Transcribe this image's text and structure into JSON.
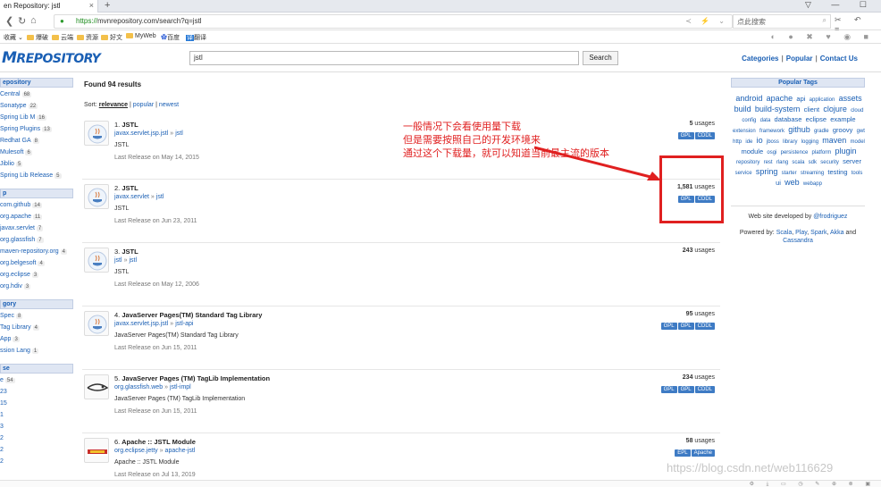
{
  "browser": {
    "tab_title": "en Repository: jstl",
    "close": "×",
    "new_tab": "+",
    "window_controls": "▽ — ☐",
    "nav_icons": {
      "back": "❮",
      "refresh": "↻",
      "home": "⌂"
    },
    "url_scheme": "https://",
    "url_rest": "mvnrepository.com/search?q=jstl",
    "url_tools": "≺ ⚡ ⌄",
    "search_placeholder": "点此搜索",
    "search_icon": "⌕",
    "menu_icons": "✂ ↶ ≡",
    "bookmarks": [
      "收藏",
      "爆破",
      "云端",
      "资源",
      "好文",
      "MyWeb",
      "百度",
      "翻译"
    ],
    "bookmarks_arrow": "⌄",
    "ext_icons": "◐ ● ✖ ♥ ◉ ■"
  },
  "site": {
    "logo_big": "M",
    "logo_text": "REPOSITORY",
    "query": "jstl",
    "search_button": "Search",
    "links": [
      "Categories",
      "Popular",
      "Contact Us"
    ],
    "link_sep": "|"
  },
  "sidebar": {
    "sections": [
      {
        "head": "epository",
        "items": [
          [
            "Central",
            "68"
          ],
          [
            "Sonatype",
            "22"
          ],
          [
            "Spring Lib M",
            "16"
          ],
          [
            "Spring Plugins",
            "13"
          ],
          [
            "Redhat GA",
            "8"
          ],
          [
            "Mulesoft",
            "6"
          ],
          [
            "Jiblio",
            "5"
          ],
          [
            "Spring Lib Release",
            "5"
          ]
        ]
      },
      {
        "head": "p",
        "items": [
          [
            "com.github",
            "14"
          ],
          [
            "org.apache",
            "11"
          ],
          [
            "javax.servlet",
            "7"
          ],
          [
            "org.glassfish",
            "7"
          ],
          [
            "maven-repository.org",
            "4"
          ],
          [
            "org.belgesoft",
            "4"
          ],
          [
            "org.eclipse",
            "3"
          ],
          [
            "org.hdiv",
            "3"
          ]
        ]
      },
      {
        "head": "gory",
        "items": [
          [
            "Spec",
            "8"
          ],
          [
            "Tag Library",
            "4"
          ],
          [
            "App",
            "3"
          ],
          [
            "ssion Lang",
            "1"
          ]
        ]
      },
      {
        "head": "se",
        "items": [
          [
            "e",
            "54"
          ],
          [
            "23",
            ""
          ],
          [
            "15",
            ""
          ],
          [
            "1",
            ""
          ],
          [
            "3",
            ""
          ],
          [
            "2",
            ""
          ],
          [
            "2",
            ""
          ],
          [
            "2",
            ""
          ]
        ]
      }
    ]
  },
  "results": {
    "found": "Found 94 results",
    "sort_label": "Sort:",
    "sort_options": [
      "relevance",
      "popular",
      "newest"
    ],
    "sort_sep": "|",
    "path_sep": "»",
    "usages_word": "usages",
    "items": [
      {
        "num": "1.",
        "title": "JSTL",
        "group": "javax.servlet.jsp.jstl",
        "artifact": "jstl",
        "desc": "JSTL",
        "date": "Last Release on May 14, 2015",
        "usages": "5",
        "licenses": [
          "GPL",
          "CDDL"
        ]
      },
      {
        "num": "2.",
        "title": "JSTL",
        "group": "javax.servlet",
        "artifact": "jstl",
        "desc": "JSTL",
        "date": "Last Release on Jun 23, 2011",
        "usages": "1,581",
        "licenses": [
          "GPL",
          "CDDL"
        ]
      },
      {
        "num": "3.",
        "title": "JSTL",
        "group": "jstl",
        "artifact": "jstl",
        "desc": "JSTL",
        "date": "Last Release on May 12, 2006",
        "usages": "243",
        "licenses": []
      },
      {
        "num": "4.",
        "title": "JavaServer Pages(TM) Standard Tag Library",
        "group": "javax.servlet.jsp.jstl",
        "artifact": "jstl-api",
        "desc": "JavaServer Pages(TM) Standard Tag Library",
        "date": "Last Release on Jun 15, 2011",
        "usages": "95",
        "licenses": [
          "GPL",
          "GPL",
          "CDDL"
        ]
      },
      {
        "num": "5.",
        "title": "JavaServer Pages (TM) TagLib Implementation",
        "group": "org.glassfish.web",
        "artifact": "jstl-impl",
        "desc": "JavaServer Pages (TM) TagLib Implementation",
        "date": "Last Release on Jun 15, 2011",
        "usages": "234",
        "licenses": [
          "GPL",
          "GPL",
          "CDDL"
        ]
      },
      {
        "num": "6.",
        "title": "Apache :: JSTL Module",
        "group": "org.eclipse.jetty",
        "artifact": "apache-jstl",
        "desc": "Apache :: JSTL Module",
        "date": "Last Release on Jul 13, 2019",
        "usages": "58",
        "licenses": [
          "EPL",
          "Apache"
        ]
      }
    ]
  },
  "right": {
    "tags_title": "Popular Tags",
    "tags": [
      [
        "android",
        3
      ],
      [
        "apache",
        3
      ],
      [
        "api",
        2
      ],
      [
        "application",
        1
      ],
      [
        "assets",
        3
      ],
      [
        "build",
        3
      ],
      [
        "build-system",
        3
      ],
      [
        "client",
        2
      ],
      [
        "clojure",
        3
      ],
      [
        "cloud",
        1
      ],
      [
        "config",
        1
      ],
      [
        "data",
        1
      ],
      [
        "database",
        2
      ],
      [
        "eclipse",
        2
      ],
      [
        "example",
        2
      ],
      [
        "extension",
        1
      ],
      [
        "framework",
        1
      ],
      [
        "github",
        3
      ],
      [
        "gradle",
        1
      ],
      [
        "groovy",
        2
      ],
      [
        "gwt",
        1
      ],
      [
        "http",
        1
      ],
      [
        "ide",
        1
      ],
      [
        "io",
        3
      ],
      [
        "jboss",
        1
      ],
      [
        "library",
        1
      ],
      [
        "logging",
        1
      ],
      [
        "maven",
        3
      ],
      [
        "model",
        1
      ],
      [
        "module",
        2
      ],
      [
        "osgi",
        1
      ],
      [
        "persistence",
        1
      ],
      [
        "platform",
        1
      ],
      [
        "plugin",
        3
      ],
      [
        "repository",
        1
      ],
      [
        "rest",
        1
      ],
      [
        "rlang",
        1
      ],
      [
        "scala",
        1
      ],
      [
        "sdk",
        1
      ],
      [
        "security",
        1
      ],
      [
        "server",
        2
      ],
      [
        "service",
        1
      ],
      [
        "spring",
        3
      ],
      [
        "starter",
        1
      ],
      [
        "streaming",
        1
      ],
      [
        "testing",
        2
      ],
      [
        "tools",
        1
      ],
      [
        "ui",
        2
      ],
      [
        "web",
        3
      ],
      [
        "webapp",
        1
      ]
    ],
    "dev_prefix": "Web site developed by",
    "dev_name": "@frodriguez",
    "powered_prefix": "Powered by:",
    "powered_parts": [
      [
        "Scala",
        ","
      ],
      [
        "Play",
        ","
      ],
      [
        "Spark",
        ","
      ],
      [
        "Akka",
        " and"
      ],
      [
        "Cassandra",
        ""
      ]
    ]
  },
  "annotation": {
    "lines": [
      "一般情况下会看使用量下载",
      "但是需要按照自己的开发环境来",
      "通过这个下载量，就可以知道当前最主流的版本"
    ],
    "color": "#e02020"
  },
  "watermark": "https://blog.csdn.net/web116629",
  "status_icons": "⚙ ⤓ ▭ ◷ ✎ ⊕ ⊗ ▣"
}
